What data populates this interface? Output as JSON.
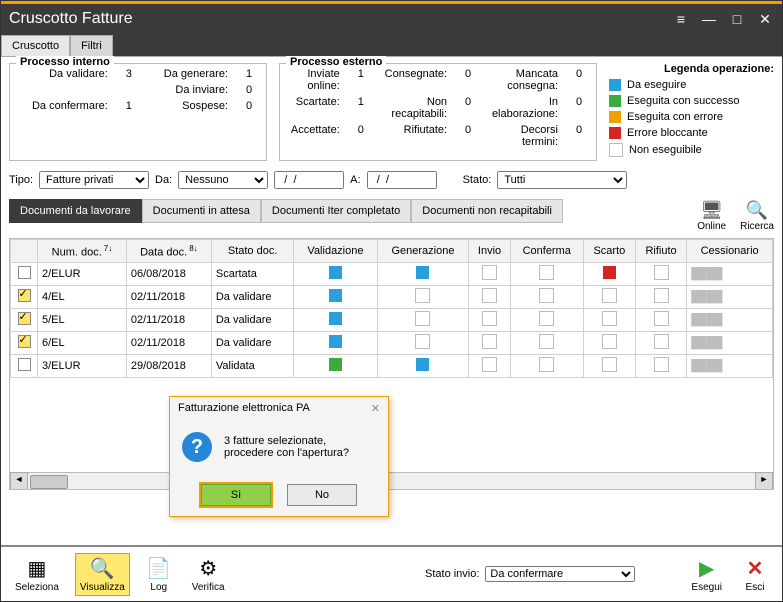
{
  "window": {
    "title": "Cruscotto Fatture"
  },
  "tabs": [
    "Cruscotto",
    "Filtri"
  ],
  "activeTab": 0,
  "procInt": {
    "legend": "Processo interno",
    "rows": [
      {
        "l1": "Da validare:",
        "v1": "3",
        "l2": "Da generare:",
        "v2": "1"
      },
      {
        "l1": "",
        "v1": "",
        "l2": "Da inviare:",
        "v2": "0"
      },
      {
        "l1": "Da confermare:",
        "v1": "1",
        "l2": "Sospese:",
        "v2": "0"
      }
    ]
  },
  "procExt": {
    "legend": "Processo esterno",
    "rows": [
      {
        "l1": "Inviate online:",
        "v1": "1",
        "l2": "Consegnate:",
        "v2": "0",
        "l3": "Mancata consegna:",
        "v3": "0"
      },
      {
        "l1": "Scartate:",
        "v1": "1",
        "l2": "Non recapitabili:",
        "v2": "0",
        "l3": "In elaborazione:",
        "v3": "0"
      },
      {
        "l1": "Accettate:",
        "v1": "0",
        "l2": "Rifiutate:",
        "v2": "0",
        "l3": "Decorsi termini:",
        "v3": "0"
      }
    ]
  },
  "legenda": {
    "title": "Legenda operazione:",
    "items": [
      {
        "color": "#29a0dc",
        "label": "Da eseguire"
      },
      {
        "color": "#3caa3c",
        "label": "Eseguita con successo"
      },
      {
        "color": "#f0a000",
        "label": "Eseguita con errore"
      },
      {
        "color": "#d62424",
        "label": "Errore bloccante"
      },
      {
        "color": "",
        "label": "Non eseguibile"
      }
    ]
  },
  "filters": {
    "tipoLabel": "Tipo:",
    "tipo": "Fatture privati",
    "daLabel": "Da:",
    "da": "Nessuno",
    "dateFrom": "  /  /",
    "aLabel": "A:",
    "dateTo": "  /  /",
    "statoLabel": "Stato:",
    "stato": "Tutti"
  },
  "topIcons": {
    "online": "Online",
    "ricerca": "Ricerca"
  },
  "subtabs": [
    "Documenti da lavorare",
    "Documenti in attesa",
    "Documenti Iter completato",
    "Documenti non recapitabili"
  ],
  "activeSubtab": 0,
  "columns": [
    "",
    "Num. doc.",
    "Data doc.",
    "Stato doc.",
    "Validazione",
    "Generazione",
    "Invio",
    "Conferma",
    "Scarto",
    "Rifiuto",
    "Cessionario"
  ],
  "rows": [
    {
      "chk": false,
      "num": "2/ELUR",
      "data": "06/08/2018",
      "stato": "Scartata",
      "val": "blue",
      "gen": "blue",
      "inv": "empty",
      "conf": "empty",
      "scarto": "red",
      "rif": "empty",
      "cess": "blurred"
    },
    {
      "chk": true,
      "num": "4/EL",
      "data": "02/11/2018",
      "stato": "Da validare",
      "val": "blue",
      "gen": "empty",
      "inv": "empty",
      "conf": "empty",
      "scarto": "empty",
      "rif": "empty",
      "cess": "blurred"
    },
    {
      "chk": true,
      "num": "5/EL",
      "data": "02/11/2018",
      "stato": "Da validare",
      "val": "blue",
      "gen": "empty",
      "inv": "empty",
      "conf": "empty",
      "scarto": "empty",
      "rif": "empty",
      "cess": "blurred"
    },
    {
      "chk": true,
      "num": "6/EL",
      "data": "02/11/2018",
      "stato": "Da validare",
      "val": "blue",
      "gen": "empty",
      "inv": "empty",
      "conf": "empty",
      "scarto": "empty",
      "rif": "empty",
      "cess": "blurred"
    },
    {
      "chk": false,
      "num": "3/ELUR",
      "data": "29/08/2018",
      "stato": "Validata",
      "val": "green",
      "gen": "blue",
      "inv": "empty",
      "conf": "empty",
      "scarto": "empty",
      "rif": "empty",
      "cess": "blurred"
    }
  ],
  "cellColors": {
    "blue": "#29a0dc",
    "green": "#3caa3c",
    "red": "#d62424",
    "empty": ""
  },
  "bottom": {
    "seleziona": "Seleziona",
    "visualizza": "Visualizza",
    "log": "Log",
    "verifica": "Verifica",
    "statoInvioLabel": "Stato invio:",
    "statoInvio": "Da confermare",
    "esegui": "Esegui",
    "esci": "Esci"
  },
  "modal": {
    "title": "Fatturazione elettronica PA",
    "line1": "3 fatture selezionate,",
    "line2": "procedere con l'apertura?",
    "yes": "Sì",
    "no": "No"
  }
}
